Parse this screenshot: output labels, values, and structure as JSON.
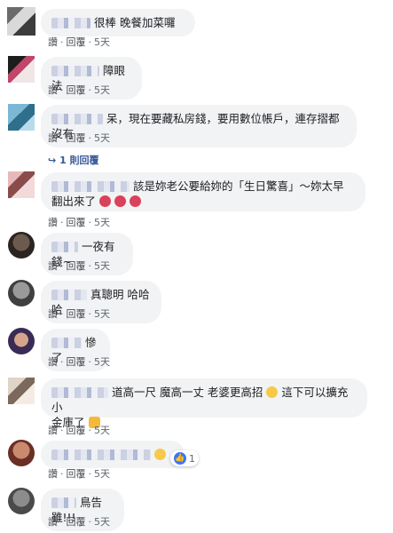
{
  "comments": [
    {
      "text": "很棒 晚餐加菜囉",
      "actions": {
        "like": "讚",
        "reply": "回覆",
        "time": "5天"
      }
    },
    {
      "text": "障眼法",
      "actions": {
        "like": "讚",
        "reply": "回覆",
        "time": "5天"
      }
    },
    {
      "text": "呆，現在要藏私房錢，要用數位帳戶，連存摺都沒有",
      "actions": {
        "like": "讚",
        "reply": "回覆",
        "time": "5天"
      },
      "replies_label": "1 則回覆"
    },
    {
      "text_line1": "該是妳老公要給妳的「生日驚喜」～妳太早",
      "text_line2": "翻出來了",
      "actions": {
        "like": "讚",
        "reply": "回覆",
        "time": "5天"
      }
    },
    {
      "text": "一夜有錢~",
      "actions": {
        "like": "讚",
        "reply": "回覆",
        "time": "5天"
      }
    },
    {
      "text": "真聰明 哈哈哈",
      "actions": {
        "like": "讚",
        "reply": "回覆",
        "time": "5天"
      }
    },
    {
      "text": "慘了",
      "actions": {
        "like": "讚",
        "reply": "回覆",
        "time": "5天"
      }
    },
    {
      "text_line1": "道高一尺 魔高一丈 老婆更高招",
      "text_line1b": "這下可以擴充小",
      "text_line2": "金庫了",
      "actions": {
        "like": "讚",
        "reply": "回覆",
        "time": "5天"
      }
    },
    {
      "text": "",
      "actions": {
        "like": "讚",
        "reply": "回覆",
        "time": "5天"
      },
      "reaction_count": "1"
    },
    {
      "text": "鳥告雖!!!",
      "actions": {
        "like": "讚",
        "reply": "回覆",
        "time": "5天"
      }
    }
  ],
  "colors": {
    "bubble": "#f2f3f5",
    "meta": "#606770",
    "link": "#385898",
    "like": "#3b76f6"
  }
}
